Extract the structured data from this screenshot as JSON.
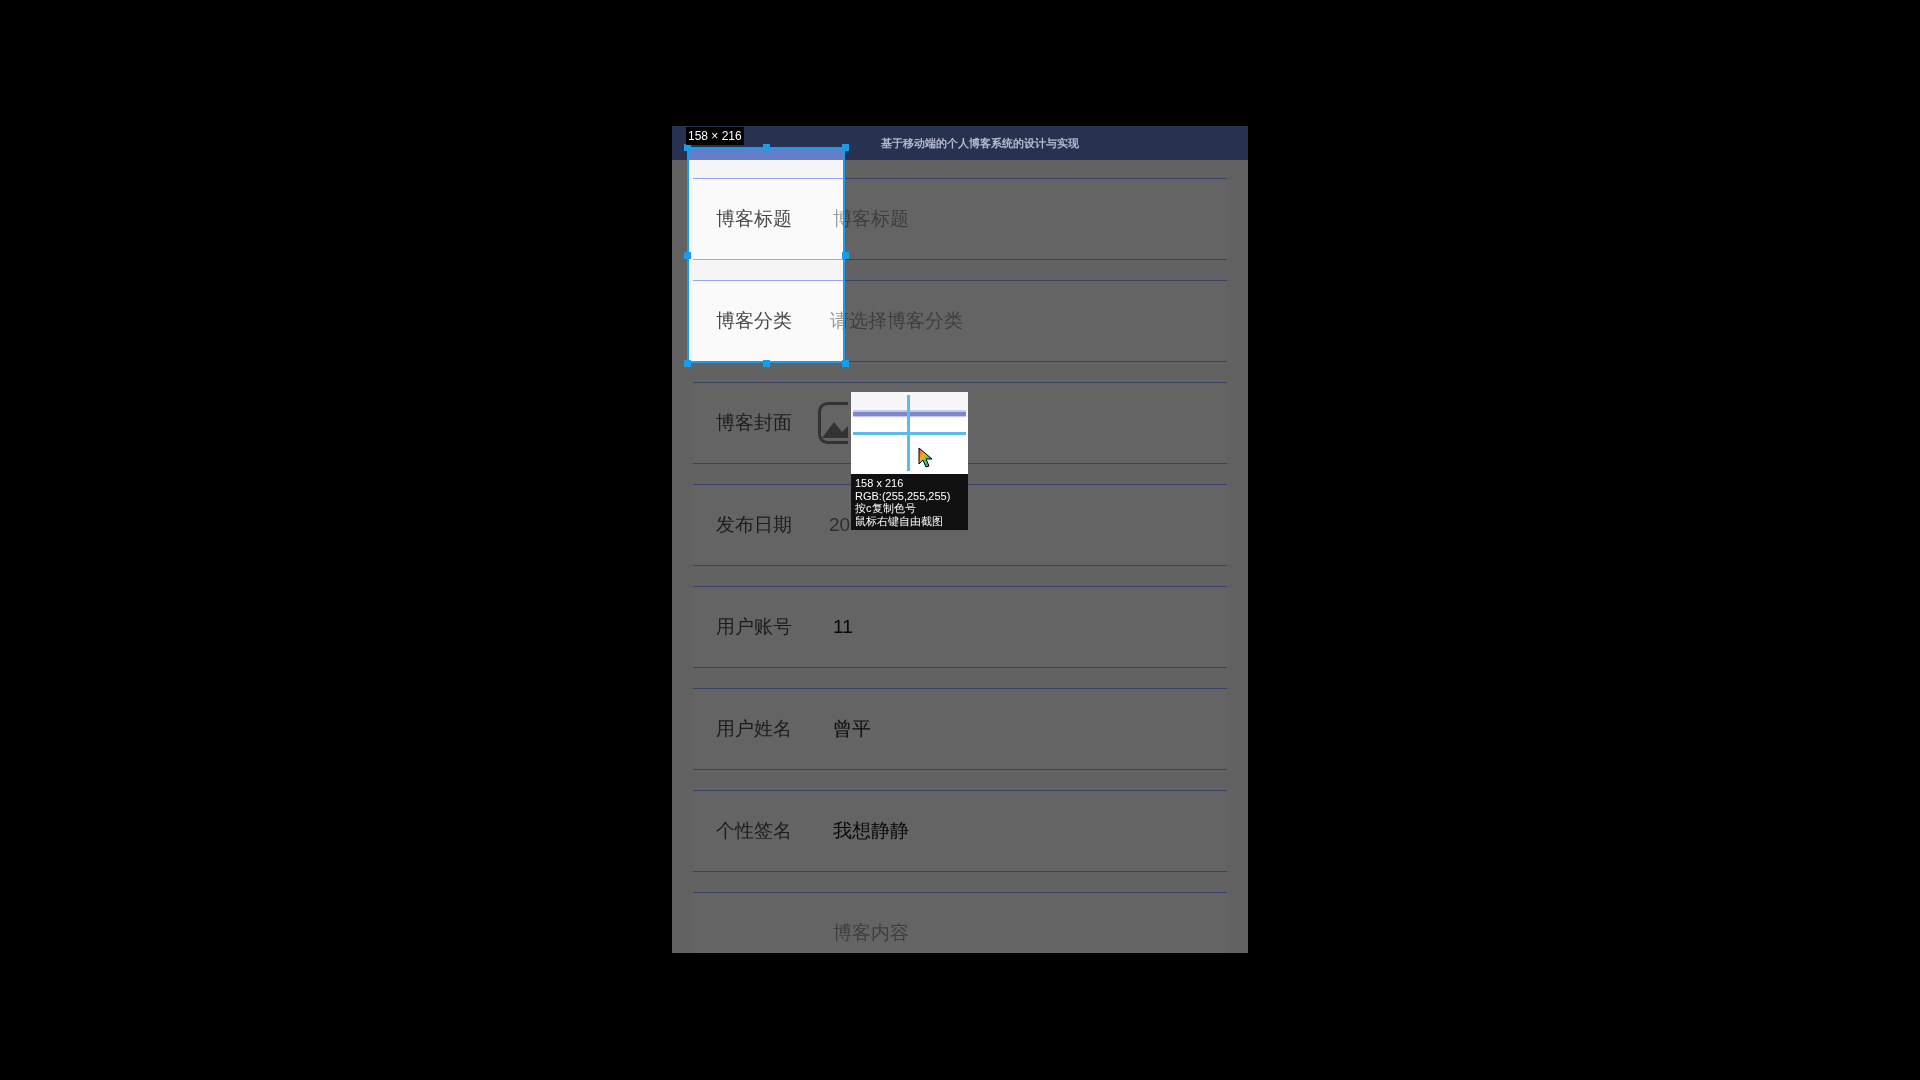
{
  "app_bar": {
    "title": "基于移动端的个人博客系统的设计与实现"
  },
  "form_rows": [
    {
      "kind": "input",
      "label": "博客标题",
      "placeholder": "博客标题"
    },
    {
      "kind": "select",
      "label": "博客分类",
      "placeholder": "请选择博客分类"
    },
    {
      "kind": "image",
      "label": "博客封面"
    },
    {
      "kind": "text",
      "label": "发布日期",
      "value": "20",
      "disabled": true
    },
    {
      "kind": "text",
      "label": "用户账号",
      "value": "11",
      "disabled": false
    },
    {
      "kind": "text",
      "label": "用户姓名",
      "value": "曾平",
      "disabled": false
    },
    {
      "kind": "text",
      "label": "个性签名",
      "value": "我想静静",
      "disabled": false
    },
    {
      "kind": "textarea",
      "placeholder": "博客内容"
    }
  ],
  "capture_overlay": {
    "size_label": "158 × 216",
    "magnifier": {
      "size": "158 x 216",
      "color_reading": "RGB:(255,255,255)",
      "hints": [
        "按c复制色号",
        "鼠标右键自由截图"
      ]
    }
  }
}
